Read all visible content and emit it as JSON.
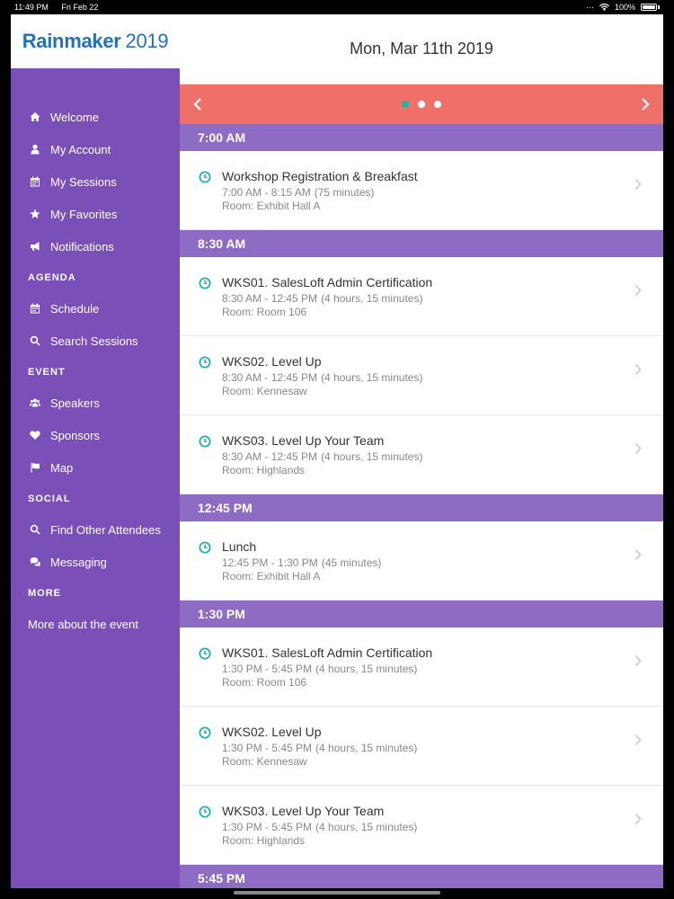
{
  "status_bar": {
    "time": "11:49 PM",
    "date": "Fri Feb 22",
    "battery": "100%"
  },
  "brand": {
    "name": "Rainmaker",
    "year": "2019",
    "color": "#2471b8"
  },
  "sidebar": {
    "items_top": [
      {
        "label": "Welcome",
        "icon": "home-icon"
      },
      {
        "label": "My Account",
        "icon": "user-icon"
      },
      {
        "label": "My Sessions",
        "icon": "calendar-icon"
      },
      {
        "label": "My Favorites",
        "icon": "star-icon"
      },
      {
        "label": "Notifications",
        "icon": "megaphone-icon"
      }
    ],
    "section_agenda": "AGENDA",
    "items_agenda": [
      {
        "label": "Schedule",
        "icon": "calendar-icon"
      },
      {
        "label": "Search Sessions",
        "icon": "search-icon"
      }
    ],
    "section_event": "EVENT",
    "items_event": [
      {
        "label": "Speakers",
        "icon": "users-icon"
      },
      {
        "label": "Sponsors",
        "icon": "heart-icon"
      },
      {
        "label": "Map",
        "icon": "flag-icon"
      }
    ],
    "section_social": "SOCIAL",
    "items_social": [
      {
        "label": "Find Other Attendees",
        "icon": "search-icon"
      },
      {
        "label": "Messaging",
        "icon": "chat-icon"
      }
    ],
    "section_more": "MORE",
    "more_link": "More about the event"
  },
  "schedule": {
    "date_title": "Mon, Mar 11th 2019",
    "blocks": [
      {
        "time": "7:00 AM",
        "sessions": [
          {
            "title": "Workshop Registration & Breakfast",
            "time": "7:00 AM - 8:15 AM",
            "duration": "(75 minutes)",
            "room": "Room: Exhibit Hall A"
          }
        ]
      },
      {
        "time": "8:30 AM",
        "sessions": [
          {
            "title": "WKS01. SalesLoft Admin Certification",
            "time": "8:30 AM - 12:45 PM",
            "duration": "(4 hours, 15 minutes)",
            "room": "Room: Room 106"
          },
          {
            "title": "WKS02. Level Up",
            "time": "8:30 AM - 12:45 PM",
            "duration": "(4 hours, 15 minutes)",
            "room": "Room: Kennesaw"
          },
          {
            "title": "WKS03. Level Up Your Team",
            "time": "8:30 AM - 12:45 PM",
            "duration": "(4 hours, 15 minutes)",
            "room": "Room: Highlands"
          }
        ]
      },
      {
        "time": "12:45 PM",
        "sessions": [
          {
            "title": "Lunch",
            "time": "12:45 PM - 1:30 PM",
            "duration": "(45 minutes)",
            "room": "Room: Exhibit Hall A"
          }
        ]
      },
      {
        "time": "1:30 PM",
        "sessions": [
          {
            "title": "WKS01. SalesLoft Admin Certification",
            "time": "1:30 PM - 5:45 PM",
            "duration": "(4 hours, 15 minutes)",
            "room": "Room: Room 106"
          },
          {
            "title": "WKS02. Level Up",
            "time": "1:30 PM - 5:45 PM",
            "duration": "(4 hours, 15 minutes)",
            "room": "Room: Kennesaw"
          },
          {
            "title": "WKS03. Level Up Your Team",
            "time": "1:30 PM - 5:45 PM",
            "duration": "(4 hours, 15 minutes)",
            "room": "Room: Highlands"
          }
        ]
      },
      {
        "time": "5:45 PM",
        "sessions": []
      }
    ]
  },
  "colors": {
    "sidebar": "#7a4fb8",
    "time_header": "#8f6cc4",
    "pager": "#ee7068",
    "clock": "#1db3a6"
  }
}
